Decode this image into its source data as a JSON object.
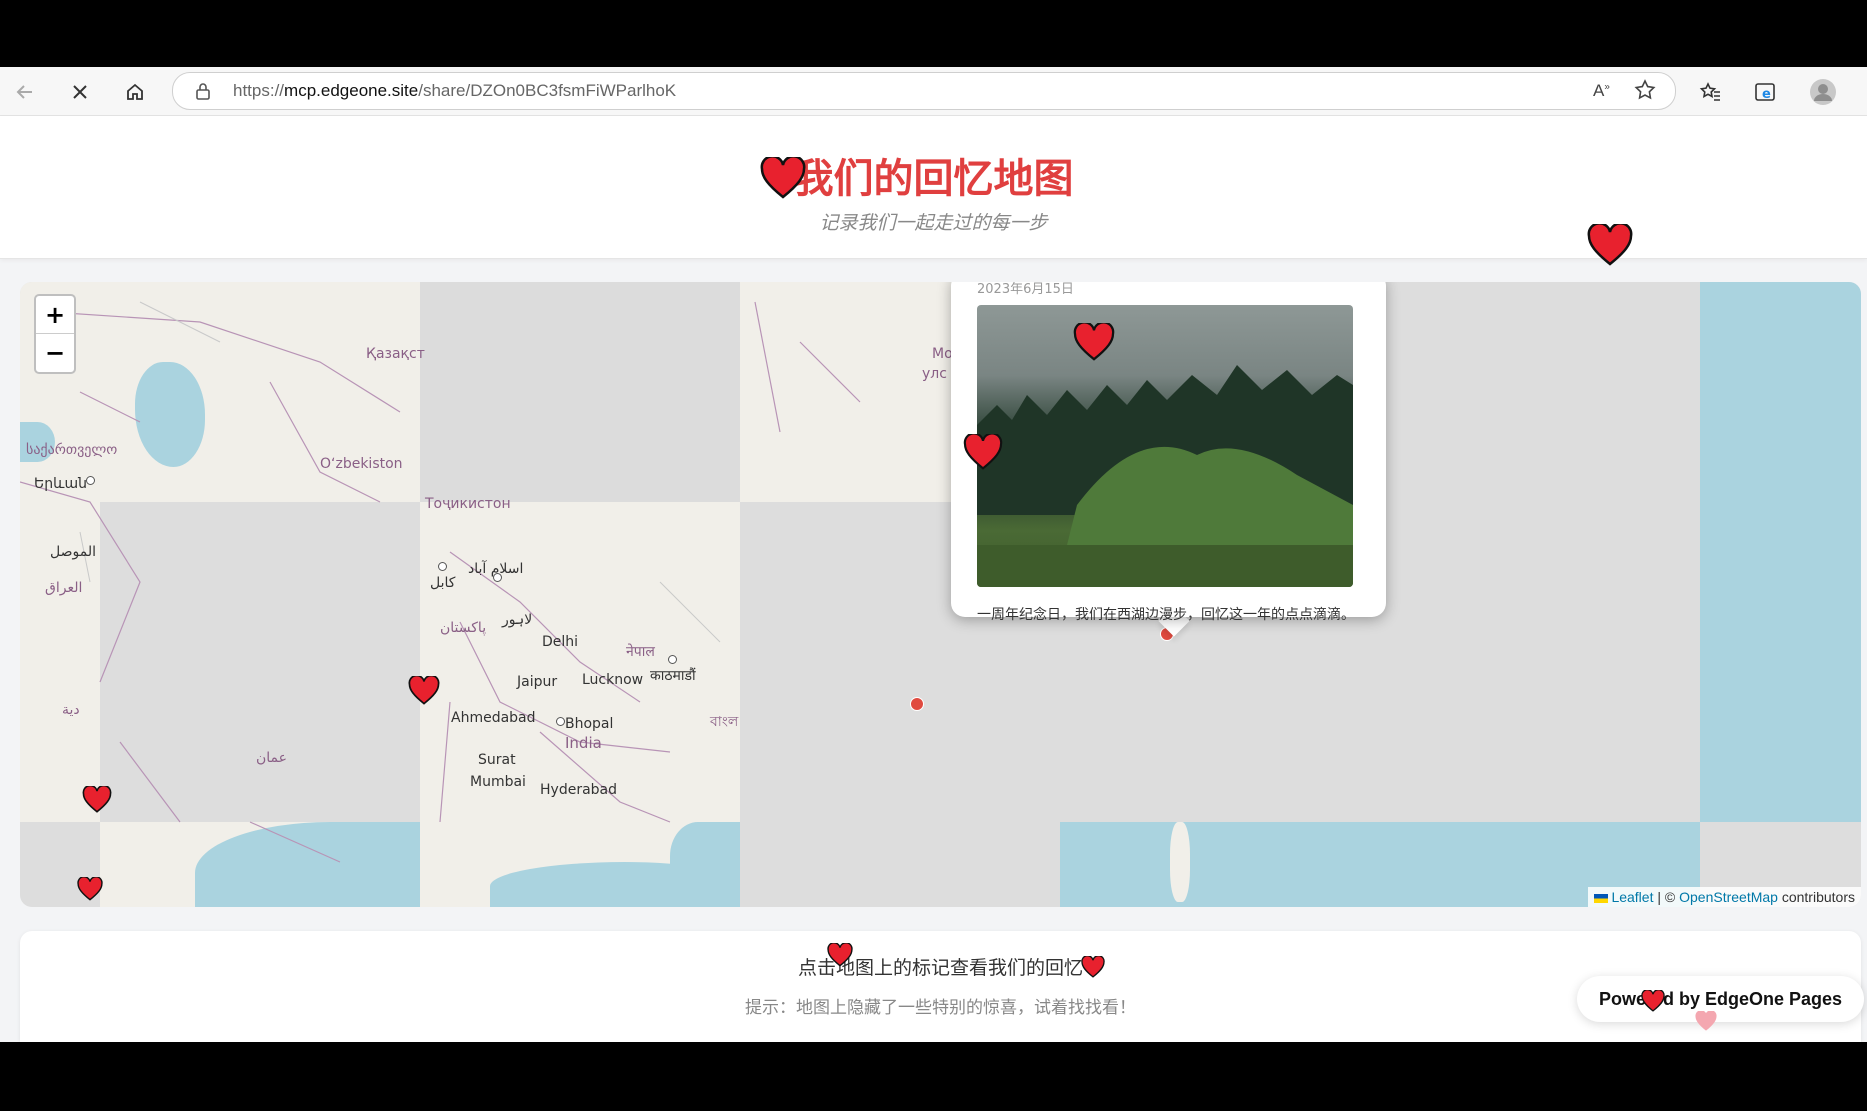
{
  "browser": {
    "url_prefix": "https://",
    "url_host": "mcp.edgeone.site",
    "url_path": "/share/DZOn0BC3fsmFiWParlhoK"
  },
  "header": {
    "title": "我们的回忆地图",
    "subtitle": "记录我们一起走过的每一步"
  },
  "map": {
    "zoom_in_label": "+",
    "zoom_out_label": "−",
    "labels": [
      "Қазақст",
      "Mo",
      "улс",
      "საქართველო",
      "Oʻzbekiston",
      "Երևան",
      "Тоҷикистон",
      "الموصل",
      "اسلام آباد",
      "کابل",
      "العراق",
      "لاہور",
      "پاکستان",
      "Delhi",
      "नेपाल",
      "काठमाडौं",
      "Jaipur",
      "Lucknow",
      "دية",
      "Ahmedabad",
      "Bhopal",
      "বাংল",
      "India",
      "عمان",
      "Surat",
      "Mumbai",
      "Hyderabad"
    ],
    "attribution_leaflet": "Leaflet",
    "attribution_sep": " | © ",
    "attribution_osm": "OpenStreetMap",
    "attribution_tail": " contributors"
  },
  "popup": {
    "date": "2023年6月15日",
    "description": "一周年纪念日，我们在西湖边漫步，回忆这一年的点点滴滴。"
  },
  "info": {
    "title": "点击地图上的标记查看我们的回忆",
    "hint": "提示：地图上隐藏了一些特别的惊喜，试着找找看！"
  },
  "footer": {
    "powered": "Powered by EdgeOne Pages"
  },
  "colors": {
    "accent": "#e03f3f",
    "marker": "#e04a3f",
    "water": "#aad3df",
    "land": "#f1efe9",
    "link": "#0078a8"
  }
}
